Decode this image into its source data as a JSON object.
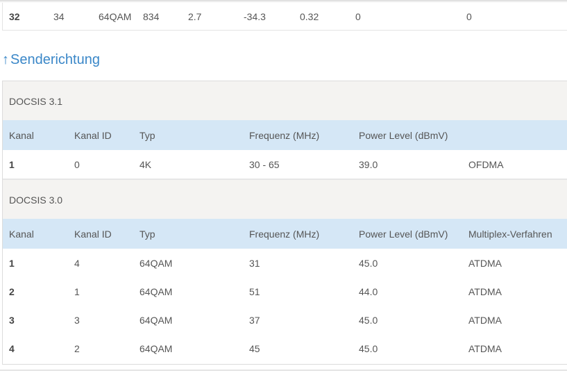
{
  "top_row": {
    "c1": "32",
    "c2": "34",
    "c3": "64QAM",
    "c4": "834",
    "c5": "2.7",
    "c6": "-34.3",
    "c7": "0.32",
    "c8": "0",
    "c9": "0"
  },
  "section_link": {
    "arrow": "↑",
    "label": "Senderichtung"
  },
  "docsis31": {
    "group_label": "DOCSIS 3.1",
    "headers": [
      "Kanal",
      "Kanal ID",
      "Typ",
      "Frequenz (MHz)",
      "Power Level (dBmV)",
      ""
    ],
    "rows": [
      [
        "1",
        "0",
        "4K",
        "30 - 65",
        "39.0",
        "OFDMA"
      ]
    ]
  },
  "docsis30": {
    "group_label": "DOCSIS 3.0",
    "headers": [
      "Kanal",
      "Kanal ID",
      "Typ",
      "Frequenz (MHz)",
      "Power Level (dBmV)",
      "Multiplex-Verfahren"
    ],
    "rows": [
      [
        "1",
        "4",
        "64QAM",
        "31",
        "45.0",
        "ATDMA"
      ],
      [
        "2",
        "1",
        "64QAM",
        "51",
        "44.0",
        "ATDMA"
      ],
      [
        "3",
        "3",
        "64QAM",
        "37",
        "45.0",
        "ATDMA"
      ],
      [
        "4",
        "2",
        "64QAM",
        "45",
        "45.0",
        "ATDMA"
      ]
    ]
  }
}
